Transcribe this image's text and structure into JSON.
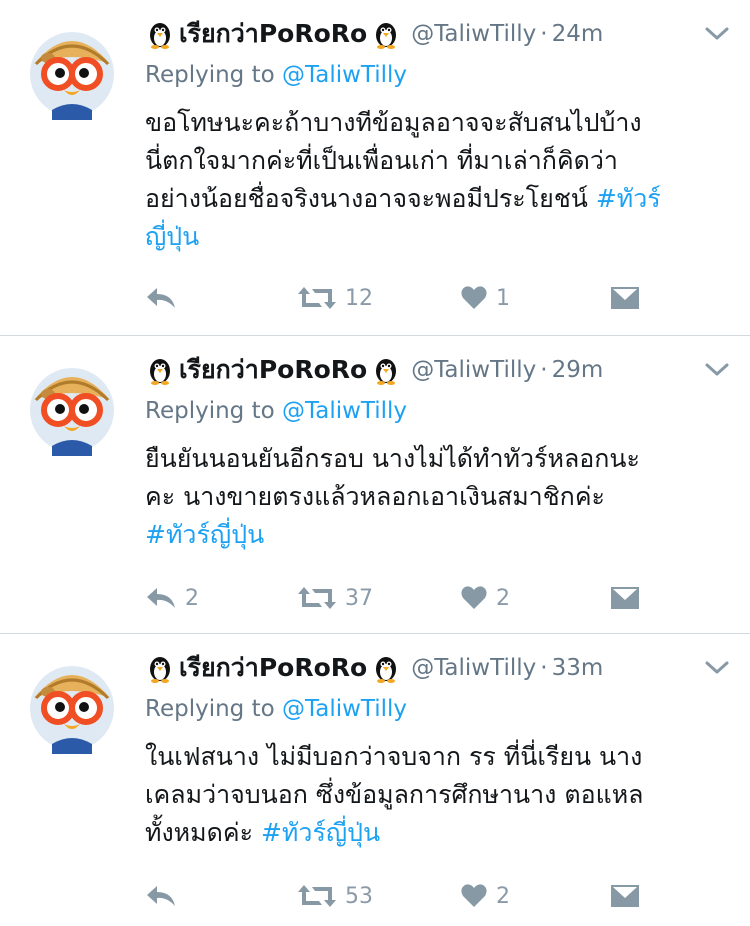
{
  "colors": {
    "accent": "#1da1f2",
    "muted": "#657786",
    "icon": "#8899a6"
  },
  "tweets": [
    {
      "display_name": "เรียกว่าPoRoRo",
      "handle": "@TaliwTilly",
      "time": "24m",
      "replying_prefix": "Replying to",
      "replying_handle": "@TaliwTilly",
      "lines": [
        "ขอโทษนะคะถ้าบางทีข้อมูลอาจจะสับสนไปบ้าง",
        "นี่ตกใจมากค่ะที่เป็นเพื่อนเก่า ที่มาเล่าก็คิดว่า",
        "อย่างน้อยชื่อจริงนางอาจจะพอมีประโยชน์ "
      ],
      "hashtag_a": "#ทัวร์",
      "hashtag_b": "ญี่ปุ่น",
      "reply_count": "",
      "retweet_count": "12",
      "like_count": "1"
    },
    {
      "display_name": "เรียกว่าPoRoRo",
      "handle": "@TaliwTilly",
      "time": "29m",
      "replying_prefix": "Replying to",
      "replying_handle": "@TaliwTilly",
      "lines": [
        "ยืนยันนอนยันอีกรอบ นางไม่ได้ทำทัวร์หลอกนะ",
        "คะ นางขายตรงแล้วหลอกเอาเงินสมาชิกค่ะ"
      ],
      "hashtag": "#ทัวร์ญี่ปุ่น",
      "reply_count": "2",
      "retweet_count": "37",
      "like_count": "2"
    },
    {
      "display_name": "เรียกว่าPoRoRo",
      "handle": "@TaliwTilly",
      "time": "33m",
      "replying_prefix": "Replying to",
      "replying_handle": "@TaliwTilly",
      "lines": [
        "ในเฟสนาง ไม่มีบอกว่าจบจาก รร ที่นี่เรียน นาง",
        "เคลมว่าจบนอก ซึ่งข้อมูลการศึกษานาง ตอแหล",
        "ทั้งหมดค่ะ "
      ],
      "hashtag": "#ทัวร์ญี่ปุ่น",
      "reply_count": "",
      "retweet_count": "53",
      "like_count": "2"
    }
  ]
}
